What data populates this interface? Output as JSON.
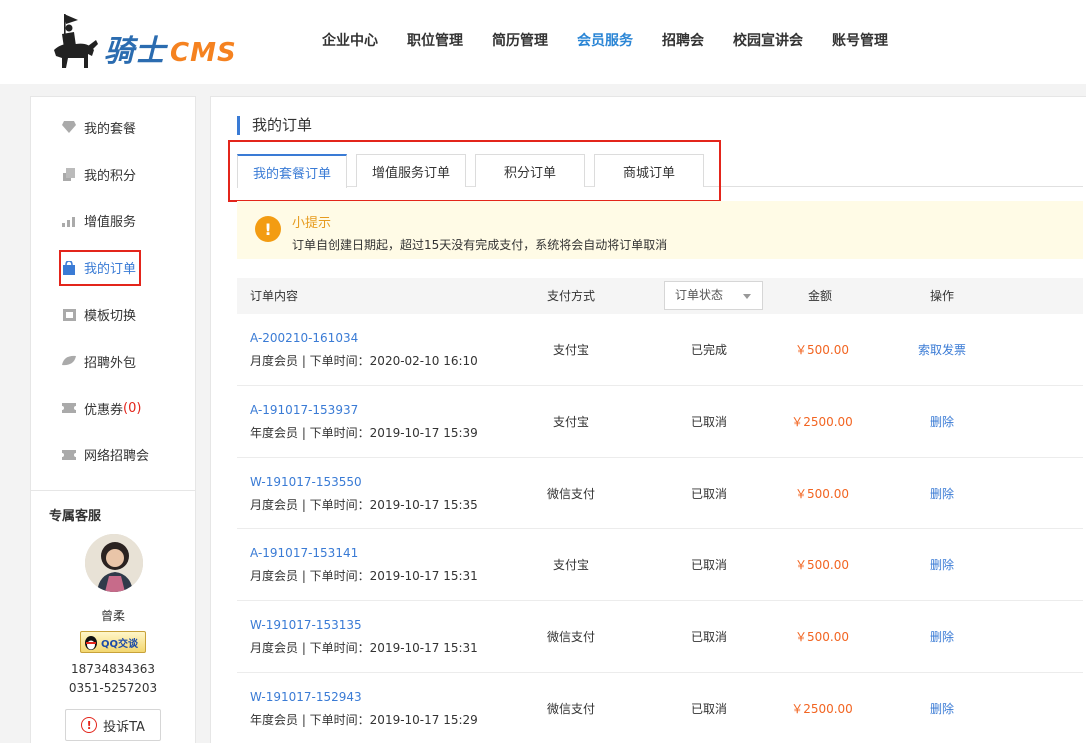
{
  "brand": {
    "name": "骑士",
    "suffix": "CMS"
  },
  "nav": [
    {
      "label": "企业中心",
      "active": false
    },
    {
      "label": "职位管理",
      "active": false
    },
    {
      "label": "简历管理",
      "active": false
    },
    {
      "label": "会员服务",
      "active": true
    },
    {
      "label": "招聘会",
      "active": false
    },
    {
      "label": "校园宣讲会",
      "active": false
    },
    {
      "label": "账号管理",
      "active": false
    }
  ],
  "sidebar": {
    "items": [
      {
        "label": "我的套餐",
        "icon": "diamond-icon"
      },
      {
        "label": "我的积分",
        "icon": "coins-icon"
      },
      {
        "label": "增值服务",
        "icon": "chart-icon"
      },
      {
        "label": "我的订单",
        "icon": "bag-icon",
        "active": true
      },
      {
        "label": "模板切换",
        "icon": "template-icon"
      },
      {
        "label": "招聘外包",
        "icon": "leaf-icon"
      },
      {
        "label": "优惠券",
        "count": "(0)",
        "icon": "ticket-icon"
      },
      {
        "label": "网络招聘会",
        "icon": "ticket-icon"
      }
    ],
    "service": {
      "title": "专属客服",
      "name": "曾柔",
      "qq_label": "QQ交谈",
      "mobile": "18734834363",
      "phone": "0351-5257203",
      "complain_label": "投诉TA"
    }
  },
  "main": {
    "title": "我的订单",
    "tabs": [
      {
        "label": "我的套餐订单",
        "active": true
      },
      {
        "label": "增值服务订单",
        "active": false
      },
      {
        "label": "积分订单",
        "active": false
      },
      {
        "label": "商城订单",
        "active": false
      }
    ],
    "tip": {
      "title": "小提示",
      "text": "订单自创建日期起，超过15天没有完成支付，系统将会自动将订单取消"
    },
    "table": {
      "headers": {
        "content": "订单内容",
        "pay": "支付方式",
        "status": "订单状态",
        "amount": "金额",
        "action": "操作"
      },
      "rows": [
        {
          "order_no": "A-200210-161034",
          "desc": "月度会员 | 下单时间：2020-02-10 16:10",
          "pay": "支付宝",
          "status": "已完成",
          "amount": "￥500.00",
          "action": "索取发票"
        },
        {
          "order_no": "A-191017-153937",
          "desc": "年度会员 | 下单时间：2019-10-17 15:39",
          "pay": "支付宝",
          "status": "已取消",
          "amount": "￥2500.00",
          "action": "删除"
        },
        {
          "order_no": "W-191017-153550",
          "desc": "月度会员 | 下单时间：2019-10-17 15:35",
          "pay": "微信支付",
          "status": "已取消",
          "amount": "￥500.00",
          "action": "删除"
        },
        {
          "order_no": "A-191017-153141",
          "desc": "月度会员 | 下单时间：2019-10-17 15:31",
          "pay": "支付宝",
          "status": "已取消",
          "amount": "￥500.00",
          "action": "删除"
        },
        {
          "order_no": "W-191017-153135",
          "desc": "月度会员 | 下单时间：2019-10-17 15:31",
          "pay": "微信支付",
          "status": "已取消",
          "amount": "￥500.00",
          "action": "删除"
        },
        {
          "order_no": "W-191017-152943",
          "desc": "年度会员 | 下单时间：2019-10-17 15:29",
          "pay": "微信支付",
          "status": "已取消",
          "amount": "￥2500.00",
          "action": "删除"
        }
      ]
    }
  }
}
